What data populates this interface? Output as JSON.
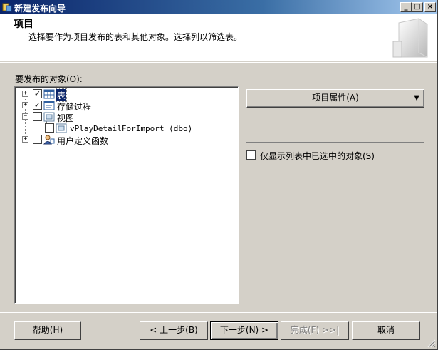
{
  "window": {
    "title": "新建发布向导",
    "minimize_glyph": "_",
    "maximize_glyph": "□",
    "close_glyph": "×"
  },
  "header": {
    "title": "项目",
    "description": "选择要作为项目发布的表和其他对象。选择列以筛选表。"
  },
  "objects": {
    "label": "要发布的对象(O):",
    "tree": [
      {
        "label": "表",
        "expander": "+",
        "checked": true,
        "selected": true,
        "icon": "table-icon"
      },
      {
        "label": "存储过程",
        "expander": "+",
        "checked": true,
        "selected": false,
        "icon": "stored-procedure-icon"
      },
      {
        "label": "视图",
        "expander": "−",
        "checked": false,
        "selected": false,
        "icon": "view-icon"
      },
      {
        "label": "vPlayDetailForImport (dbo)",
        "checked": false,
        "selected": false,
        "icon": "view-icon"
      },
      {
        "label": "用户定义函数",
        "expander": "+",
        "checked": false,
        "selected": false,
        "icon": "function-icon"
      }
    ]
  },
  "right_panel": {
    "props_button": "项目属性(A)",
    "props_arrow": "▼",
    "only_selected_label": "仅显示列表中已选中的对象(S)",
    "only_selected_checked": false
  },
  "footer": {
    "help": "帮助(H)",
    "back": "< 上一步(B)",
    "next": "下一步(N) >",
    "finish": "完成(F) >>|",
    "cancel": "取消"
  },
  "check_glyph": "✓",
  "colors": {
    "title_start": "#0a246a",
    "title_end": "#a6caf0",
    "face": "#d4d0c8",
    "selection": "#0a246a"
  }
}
